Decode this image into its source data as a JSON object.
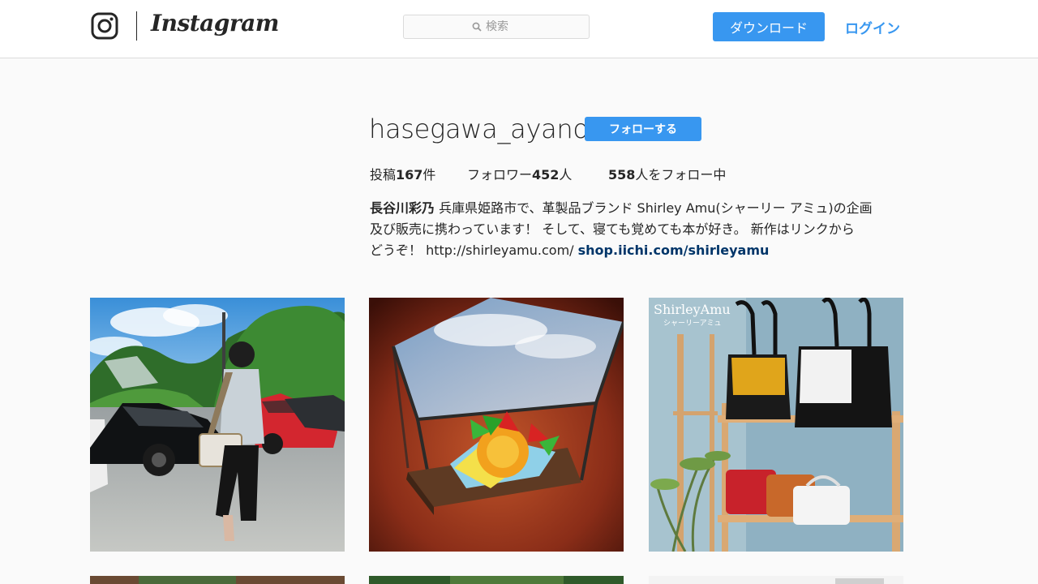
{
  "header": {
    "logo_text": "Instagram",
    "search_placeholder": "検索",
    "download_label": "ダウンロード",
    "login_label": "ログイン"
  },
  "profile": {
    "username": "hasegawa_ayano",
    "follow_label": "フォローする",
    "stats": {
      "posts_prefix": "投稿",
      "posts_count": "167",
      "posts_suffix": "件",
      "followers_prefix": "フォロワー",
      "followers_count": "452",
      "followers_suffix": "人",
      "following_count": "558",
      "following_suffix": "人をフォロー中"
    },
    "bio": {
      "name": "長谷川彩乃",
      "line1_rest": " 兵庫県姫路市で、革製品ブランド Shirley Amu(シャーリー アミュ)の企画",
      "line2": "及び販売に携わっています！ そして、寝ても覚めても本が好き。 新作はリンクから",
      "line3_text": "どうぞ！ http://shirleyamu.com/ ",
      "link": "shop.iichi.com/shirleyamu"
    }
  },
  "posts": {
    "tile3_brand": "ShirleyAmu",
    "tile3_sub": "シャーリーアミュ"
  },
  "colors": {
    "accent": "#3897f0",
    "link": "#003569",
    "background": "#fafafa",
    "border": "#dbdbdb"
  },
  "icons": [
    "instagram-camera-icon",
    "search-icon"
  ]
}
